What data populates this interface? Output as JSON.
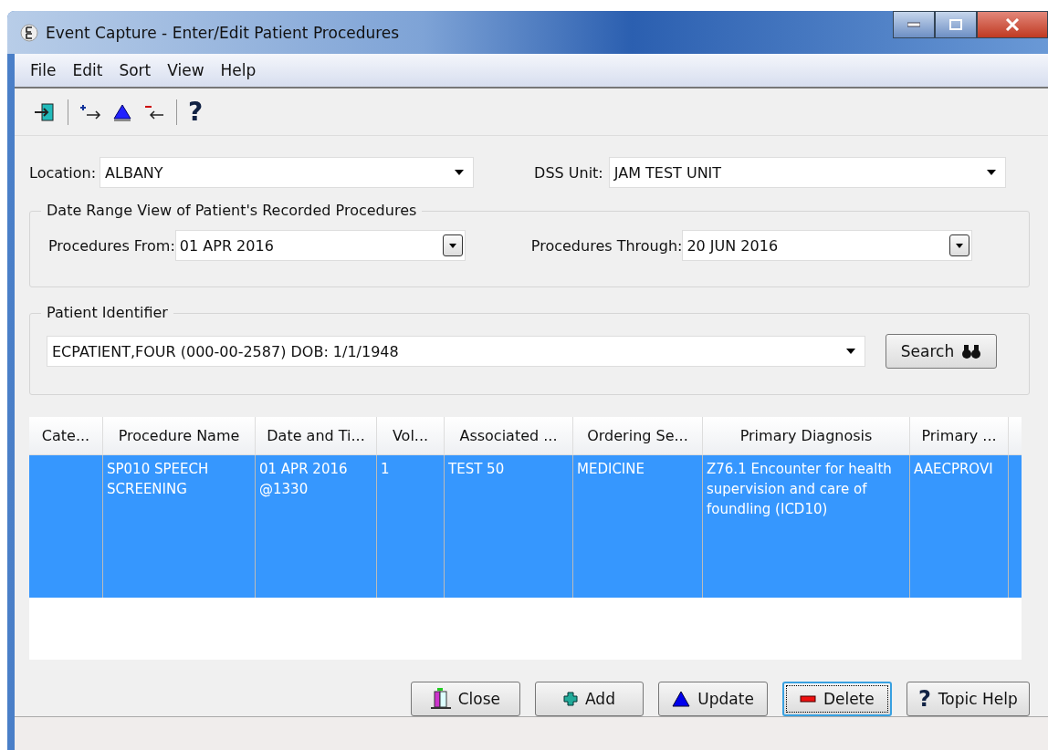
{
  "window": {
    "title": "Event Capture - Enter/Edit Patient Procedures"
  },
  "menu": [
    "File",
    "Edit",
    "Sort",
    "View",
    "Help"
  ],
  "toolbar": {
    "help_glyph": "?"
  },
  "location": {
    "label": "Location:",
    "value": "ALBANY"
  },
  "dss_unit": {
    "label": "DSS Unit:",
    "value": "JAM TEST UNIT"
  },
  "date_range": {
    "title": "Date Range View of Patient's Recorded Procedures",
    "from": {
      "label": "Procedures From:",
      "value": "01 APR 2016"
    },
    "through": {
      "label": "Procedures Through:",
      "value": "20 JUN 2016"
    }
  },
  "patient": {
    "title": "Patient Identifier",
    "value": "ECPATIENT,FOUR  (000-00-2587)  DOB: 1/1/1948",
    "search": "Search"
  },
  "table": {
    "columns": [
      "Cate...",
      "Procedure Name",
      "Date and Ti...",
      "Vol...",
      "Associated ...",
      "Ordering Se...",
      "Primary Diagnosis",
      "Primary ..."
    ],
    "rows": [
      {
        "selected": true,
        "cells": [
          "",
          "SP010 SPEECH SCREENING",
          "01 APR 2016 @1330",
          "1",
          "TEST 50",
          "MEDICINE",
          "Z76.1 Encounter for health supervision and care of foundling (ICD10)",
          "AAECPROVI"
        ]
      }
    ]
  },
  "buttons": [
    {
      "kind": "close",
      "label": "Close",
      "focused": false
    },
    {
      "kind": "add",
      "label": "Add",
      "focused": false
    },
    {
      "kind": "update",
      "label": "Update",
      "focused": false
    },
    {
      "kind": "delete",
      "label": "Delete",
      "focused": true
    },
    {
      "kind": "help",
      "label": "Topic Help",
      "focused": false,
      "icon": "?"
    }
  ]
}
